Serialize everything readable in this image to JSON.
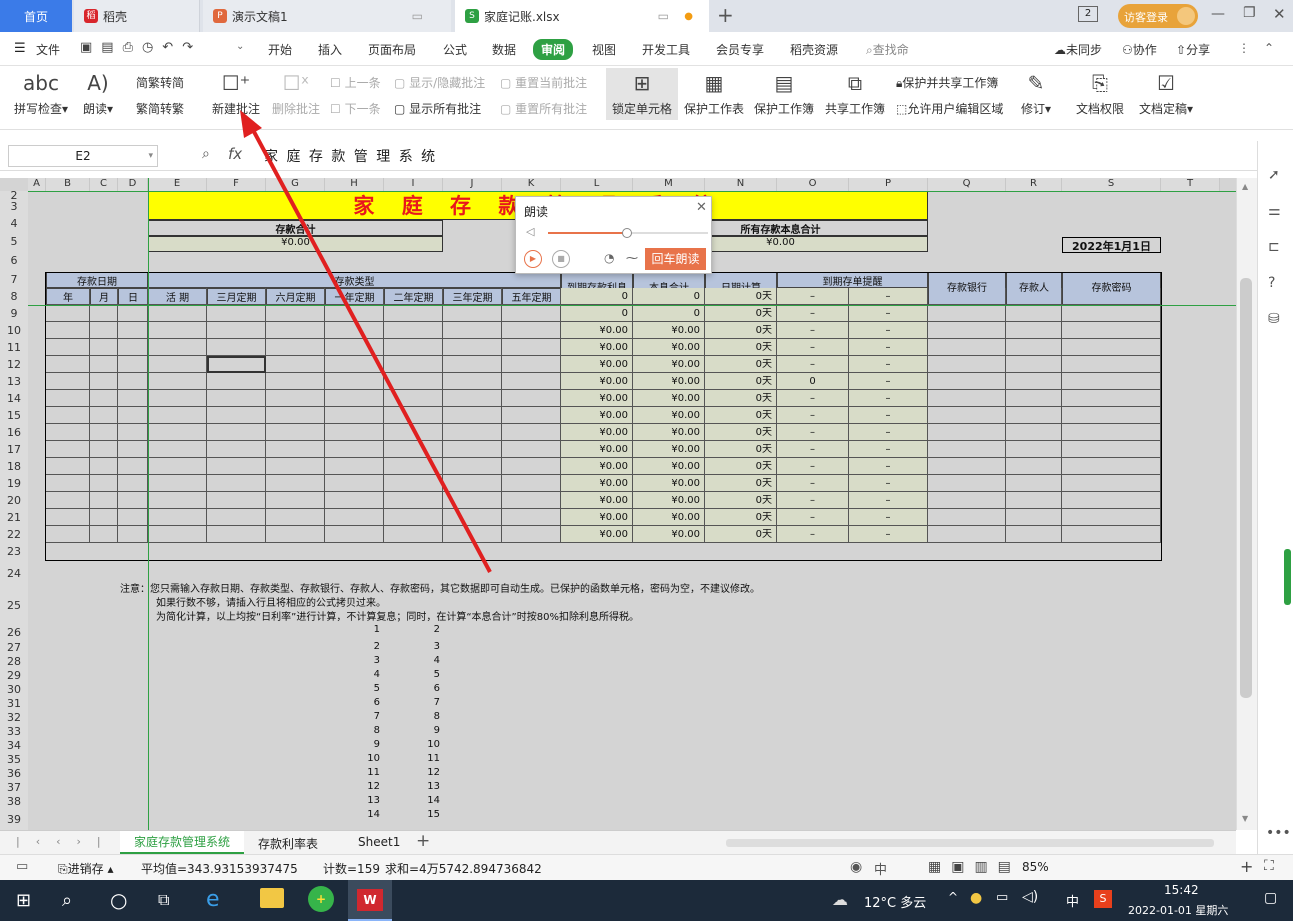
{
  "tabs": {
    "home": "首页",
    "t1": "稻壳",
    "t2": "演示文稿1",
    "t3": "家庭记账.xlsx",
    "login": "访客登录",
    "badge": "2"
  },
  "menu": {
    "file": "文件",
    "items": [
      "开始",
      "插入",
      "页面布局",
      "公式",
      "数据",
      "审阅",
      "视图",
      "开发工具",
      "会员专享",
      "稻壳资源"
    ],
    "search": "查找命",
    "sync": "未同步",
    "collab": "协作",
    "share": "分享"
  },
  "ribbon": {
    "spell": "拼写检查",
    "read": "朗读",
    "t2s": "繁转简",
    "s2t": "简转繁",
    "new_comment": "新建批注",
    "del_comment": "删除批注",
    "prev": "上一条",
    "next": "下一条",
    "show_hide": "显示/隐藏批注",
    "show_all": "显示所有批注",
    "reset_cur": "重置当前批注",
    "reset_all": "重置所有批注",
    "lock_cell": "锁定单元格",
    "protect_sheet": "保护工作表",
    "protect_book": "保护工作簿",
    "share_book": "共享工作簿",
    "protect_share": "保护并共享工作簿",
    "allow_edit": "允许用户编辑区域",
    "revise": "修订",
    "doc_perm": "文档权限",
    "doc_final": "文档定稿"
  },
  "formula": {
    "cell_ref": "E2",
    "fx": "fx",
    "content": "家 庭 存 款 管 理 系 统"
  },
  "sheet": {
    "columns": [
      "A",
      "B",
      "C",
      "D",
      "E",
      "F",
      "G",
      "H",
      "I",
      "J",
      "K",
      "L",
      "M",
      "N",
      "O",
      "P",
      "Q",
      "R",
      "S",
      "T"
    ],
    "rows": [
      "2",
      "3",
      "4",
      "5",
      "6",
      "7",
      "8",
      "9",
      "10",
      "11",
      "12",
      "13",
      "14",
      "15",
      "16",
      "17",
      "18",
      "19",
      "20",
      "21",
      "22",
      "23",
      "24",
      "25",
      "26",
      "27",
      "28",
      "29",
      "30",
      "31",
      "32",
      "33",
      "34",
      "35",
      "36",
      "37",
      "38",
      "39"
    ],
    "title": "家 庭 存 款 管 理 系 统",
    "deposit_total_label": "存款合计",
    "deposit_total": "¥0.00",
    "all_total_label": "所有存款本息合计",
    "all_total": "¥0.00",
    "date": "2022年1月1日",
    "hdr_date": "存款日期",
    "hdr_year": "年",
    "hdr_month": "月",
    "hdr_day": "日",
    "hdr_type": "存款类型",
    "types": [
      "活  期",
      "三月定期",
      "六月定期",
      "一年定期",
      "二年定期",
      "三年定期",
      "五年定期"
    ],
    "hdr_interest": "到期存款利息",
    "hdr_total": "本息合计",
    "hdr_days": "日期计算",
    "hdr_remind": "到期存单提醒",
    "hdr_month_remind": "月到期提醒",
    "hdr_year_remind": "年到期提醒",
    "hdr_bank": "存款银行",
    "hdr_person": "存款人",
    "hdr_pwd": "存款密码",
    "data_rows": [
      [
        "0",
        "0",
        "0天",
        "–",
        "–"
      ],
      [
        "0",
        "0",
        "0天",
        "–",
        "–"
      ],
      [
        "¥0.00",
        "¥0.00",
        "0天",
        "–",
        "–"
      ],
      [
        "¥0.00",
        "¥0.00",
        "0天",
        "–",
        "–"
      ],
      [
        "¥0.00",
        "¥0.00",
        "0天",
        "–",
        "–"
      ],
      [
        "¥0.00",
        "¥0.00",
        "0天",
        "0",
        "–"
      ],
      [
        "¥0.00",
        "¥0.00",
        "0天",
        "–",
        "–"
      ],
      [
        "¥0.00",
        "¥0.00",
        "0天",
        "–",
        "–"
      ],
      [
        "¥0.00",
        "¥0.00",
        "0天",
        "–",
        "–"
      ],
      [
        "¥0.00",
        "¥0.00",
        "0天",
        "–",
        "–"
      ],
      [
        "¥0.00",
        "¥0.00",
        "0天",
        "–",
        "–"
      ],
      [
        "¥0.00",
        "¥0.00",
        "0天",
        "–",
        "–"
      ],
      [
        "¥0.00",
        "¥0.00",
        "0天",
        "–",
        "–"
      ],
      [
        "¥0.00",
        "¥0.00",
        "0天",
        "–",
        "–"
      ],
      [
        "¥0.00",
        "¥0.00",
        "0天",
        "–",
        "–"
      ]
    ],
    "note1": "注意：您只需输入存款日期、存款类型、存款银行、存款人、存款密码，其它数据即可自动生成。已保护的函数单元格，密码为空，不建议修改。",
    "note2": "如果行数不够，请插入行且将相应的公式拷贝过来。",
    "note3": "为简化计算，以上均按“日利率”进行计算，不计算复息；同时，在计算“本息合计”时按80%扣除利息所得税。",
    "seq_a": [
      "1",
      "2",
      "3",
      "4",
      "5",
      "6",
      "7",
      "8",
      "9",
      "10",
      "11",
      "12",
      "13",
      "14"
    ],
    "seq_b": [
      "2",
      "3",
      "4",
      "5",
      "6",
      "7",
      "8",
      "9",
      "10",
      "11",
      "12",
      "13",
      "14",
      "15"
    ]
  },
  "dialog": {
    "title": "朗读",
    "play_btn": "回车朗读"
  },
  "sheettabs": [
    "家庭存款管理系统",
    "存款利率表",
    "Sheet1"
  ],
  "status": {
    "save": "进销存",
    "avg": "平均值=343.93153937475",
    "count": "计数=159",
    "sum": "求和=4万5742.894736842",
    "zoom": "85%"
  },
  "taskbar": {
    "weather": "12°C 多云",
    "ime": "中",
    "time": "15:42",
    "date": "2022-01-01 星期六"
  },
  "colors": {
    "title_bg": "#ffff00",
    "title_fg": "#e8171c",
    "header_bg": "#b7c4dc",
    "money_bg": "#d8dcc8",
    "accent": "#2ea043"
  }
}
